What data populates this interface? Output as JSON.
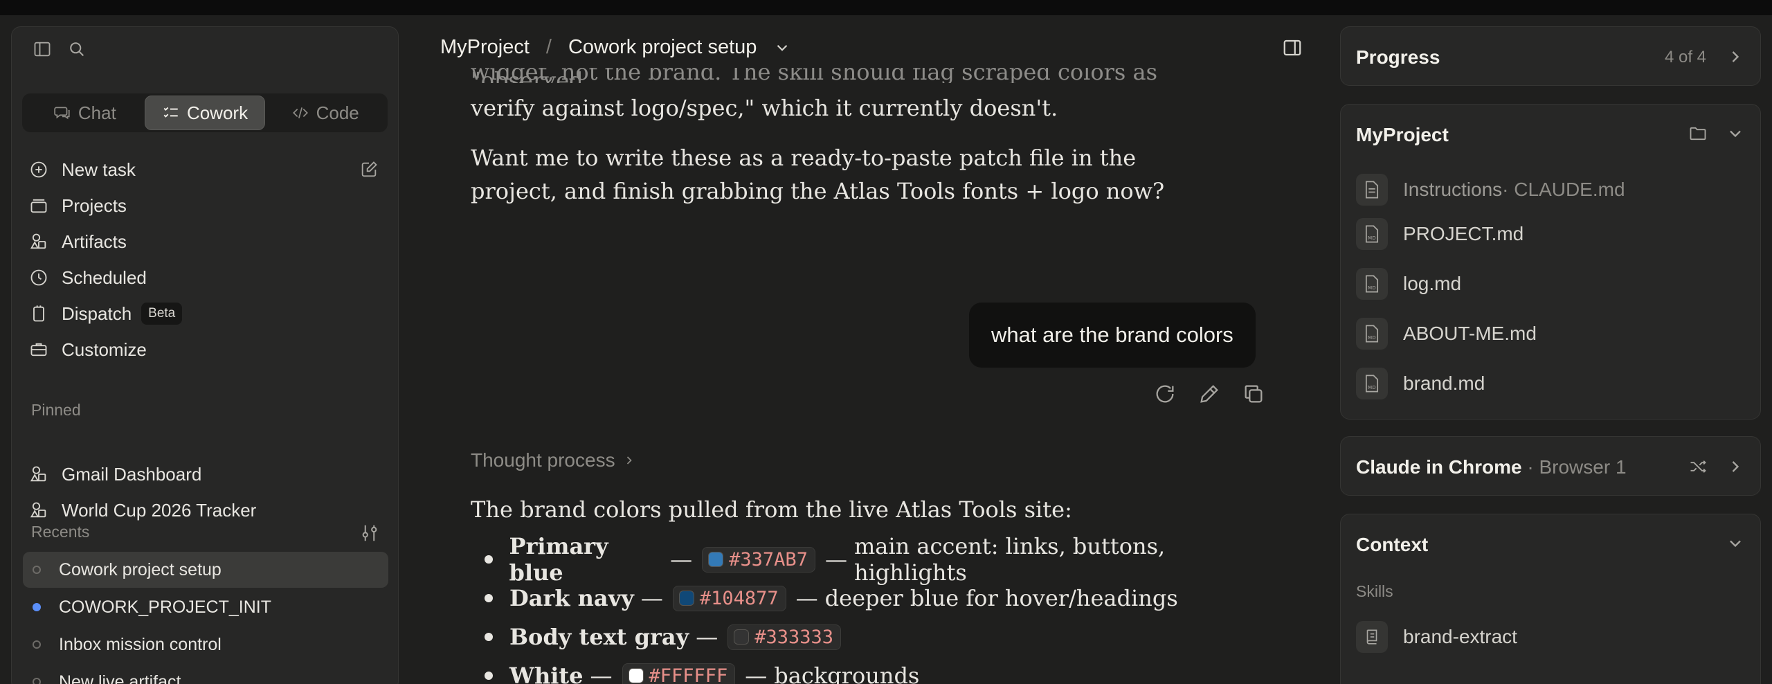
{
  "sidebar": {
    "modes": [
      {
        "label": "Chat",
        "active": false
      },
      {
        "label": "Cowork",
        "active": true
      },
      {
        "label": "Code",
        "active": false
      }
    ],
    "nav": {
      "new_task": "New task",
      "projects": "Projects",
      "artifacts": "Artifacts",
      "scheduled": "Scheduled",
      "dispatch": "Dispatch",
      "dispatch_badge": "Beta",
      "customize": "Customize"
    },
    "pinned_label": "Pinned",
    "pinned": [
      "Gmail Dashboard",
      "World Cup 2026 Tracker"
    ],
    "recents_label": "Recents",
    "recents": [
      "Cowork project setup",
      "COWORK_PROJECT_INIT",
      "Inbox mission control",
      "New live artifact"
    ]
  },
  "main": {
    "breadcrumb": {
      "project": "MyProject",
      "separator": "/",
      "chat": "Cowork project setup"
    },
    "prev_cutoff": "widget, not the brand. The skill should flag scraped colors as \"observed,",
    "prev_text": "verify against logo/spec,\" which it currently doesn't.",
    "prev_question": "Want me to write these as a ready-to-paste patch file in the project, and finish grabbing the Atlas Tools fonts + logo now?",
    "user_message": "what are the brand colors",
    "thought_label": "Thought process",
    "answer_intro": "The brand colors pulled from the live Atlas Tools site:",
    "colors": [
      {
        "name": "Primary blue",
        "hex": "#337AB7",
        "desc": "main accent: links, buttons, highlights"
      },
      {
        "name": "Dark navy",
        "hex": "#104877",
        "desc": "deeper blue for hover/headings"
      },
      {
        "name": "Body text gray",
        "hex": "#333333",
        "desc": ""
      },
      {
        "name": "White",
        "hex": "#FFFFFF",
        "desc": "backgrounds"
      }
    ],
    "dash": "—"
  },
  "right": {
    "progress": {
      "title": "Progress",
      "count": "4 of 4"
    },
    "project": {
      "title": "MyProject",
      "files": [
        {
          "name": "Instructions",
          "sub": " · CLAUDE.md"
        },
        {
          "name": "PROJECT.md",
          "sub": ""
        },
        {
          "name": "log.md",
          "sub": ""
        },
        {
          "name": "ABOUT-ME.md",
          "sub": ""
        },
        {
          "name": "brand.md",
          "sub": ""
        }
      ]
    },
    "chrome": {
      "title": "Claude in Chrome",
      "sub": " · Browser 1"
    },
    "context": {
      "title": "Context",
      "skills_label": "Skills",
      "skill": "brand-extract"
    }
  }
}
